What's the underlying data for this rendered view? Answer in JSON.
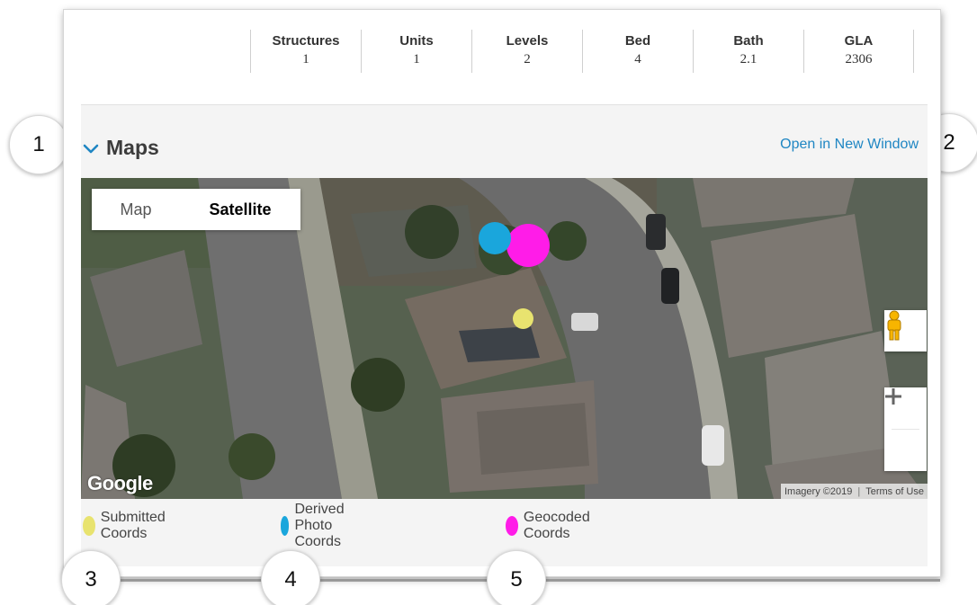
{
  "stats": [
    {
      "label": "Structures",
      "value": "1"
    },
    {
      "label": "Units",
      "value": "1"
    },
    {
      "label": "Levels",
      "value": "2"
    },
    {
      "label": "Bed",
      "value": "4"
    },
    {
      "label": "Bath",
      "value": "2.1"
    },
    {
      "label": "GLA",
      "value": "2306"
    }
  ],
  "maps": {
    "title": "Maps",
    "open_link": "Open in New Window",
    "map_type": {
      "map_label": "Map",
      "satellite_label": "Satellite",
      "selected": "Satellite"
    },
    "zoom_in_icon": "plus-icon",
    "zoom_out_icon": "minus-icon",
    "pegman_icon": "pegman-icon",
    "google_logo": "Google",
    "attribution": {
      "imagery": "Imagery ©2019",
      "terms": "Terms of Use"
    }
  },
  "legend": [
    {
      "label": "Submitted Coords",
      "color": "#e8e36f"
    },
    {
      "label": "Derived Photo Coords",
      "color": "#1aa6dc"
    },
    {
      "label": "Geocoded Coords",
      "color": "#ff1ce8"
    }
  ],
  "callouts": [
    "1",
    "2",
    "3",
    "4",
    "5"
  ],
  "colors": {
    "link": "#1f86c3",
    "chevron": "#1f86c3"
  }
}
